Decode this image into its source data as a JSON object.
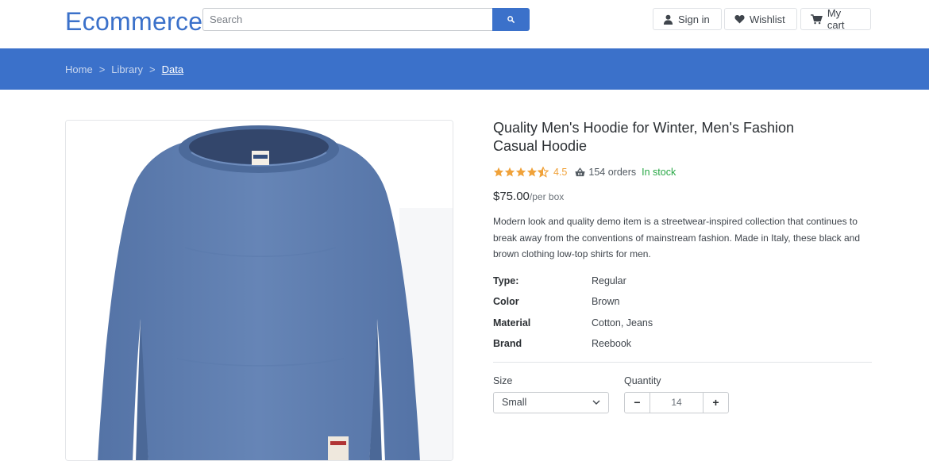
{
  "header": {
    "logo": "Ecommerce",
    "search_placeholder": "Search",
    "sign_in": "Sign in",
    "wishlist": "Wishlist",
    "cart": "My cart"
  },
  "breadcrumb": {
    "items": [
      "Home",
      "Library"
    ],
    "active": "Data",
    "separator": ">"
  },
  "product": {
    "title": "Quality Men's Hoodie for Winter, Men's Fashion Casual Hoodie",
    "rating": "4.5",
    "orders": "154 orders",
    "stock": "In stock",
    "price": "$75.00",
    "price_unit": "/per box",
    "description": "Modern look and quality demo item is a streetwear-inspired collection that continues to break away from the conventions of mainstream fashion. Made in Italy, these black and brown clothing low-top shirts for men.",
    "specs": [
      {
        "key": "Type:",
        "value": "Regular"
      },
      {
        "key": "Color",
        "value": "Brown"
      },
      {
        "key": "Material",
        "value": "Cotton, Jeans"
      },
      {
        "key": "Brand",
        "value": "Reebook"
      }
    ],
    "size_label": "Size",
    "size_value": "Small",
    "quantity_label": "Quantity",
    "quantity_value": "14",
    "minus": "−",
    "plus": "+"
  },
  "colors": {
    "accent": "#3b71ca",
    "star": "#f0a23a",
    "in_stock": "#28a745",
    "shirt": "#5f7fb0"
  }
}
